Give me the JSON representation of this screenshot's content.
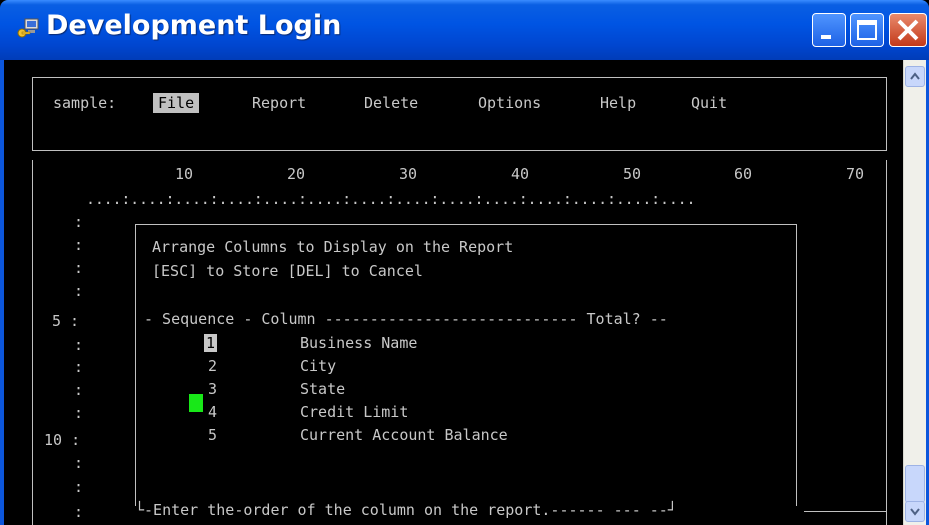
{
  "window": {
    "title": "Development Login",
    "icons": {
      "app": "key-computer-icon",
      "minimize": "minimize-icon",
      "maximize": "maximize-icon",
      "close": "close-icon"
    }
  },
  "menu": {
    "prefix": "sample:",
    "items": [
      "File",
      "Report",
      "Delete",
      "Options",
      "Help",
      "Quit"
    ],
    "selected": "File"
  },
  "ruler": {
    "numbers": [
      "10",
      "20",
      "30",
      "40",
      "50",
      "60",
      "70"
    ],
    "ticks": "....:....:....:....:....:....:....:....:....:....:....:....:....:...."
  },
  "gutter": [
    ":",
    ":",
    ":",
    ":",
    "5 :",
    ":",
    ":",
    ":",
    ":",
    "10 :",
    ":",
    ":",
    ":"
  ],
  "dialog": {
    "line1": "Arrange Columns to Display on the Report",
    "line2": "[ESC] to Store [DEL] to Cancel",
    "header": "- Sequence - Column ---------------------------- Total? --",
    "rows": [
      {
        "seq": "1",
        "column": "Business Name"
      },
      {
        "seq": "2",
        "column": "City"
      },
      {
        "seq": "3",
        "column": "State"
      },
      {
        "seq": "4",
        "column": "Credit Limit"
      },
      {
        "seq": "5",
        "column": "Current Account Balance"
      }
    ],
    "footer": "└-Enter the-order of the column on the report.------ --- --┘"
  },
  "colors": {
    "titlebar": "#0054e3",
    "terminal_bg": "#000000",
    "terminal_fg": "#c8c8c8",
    "cursor": "#18e818"
  }
}
